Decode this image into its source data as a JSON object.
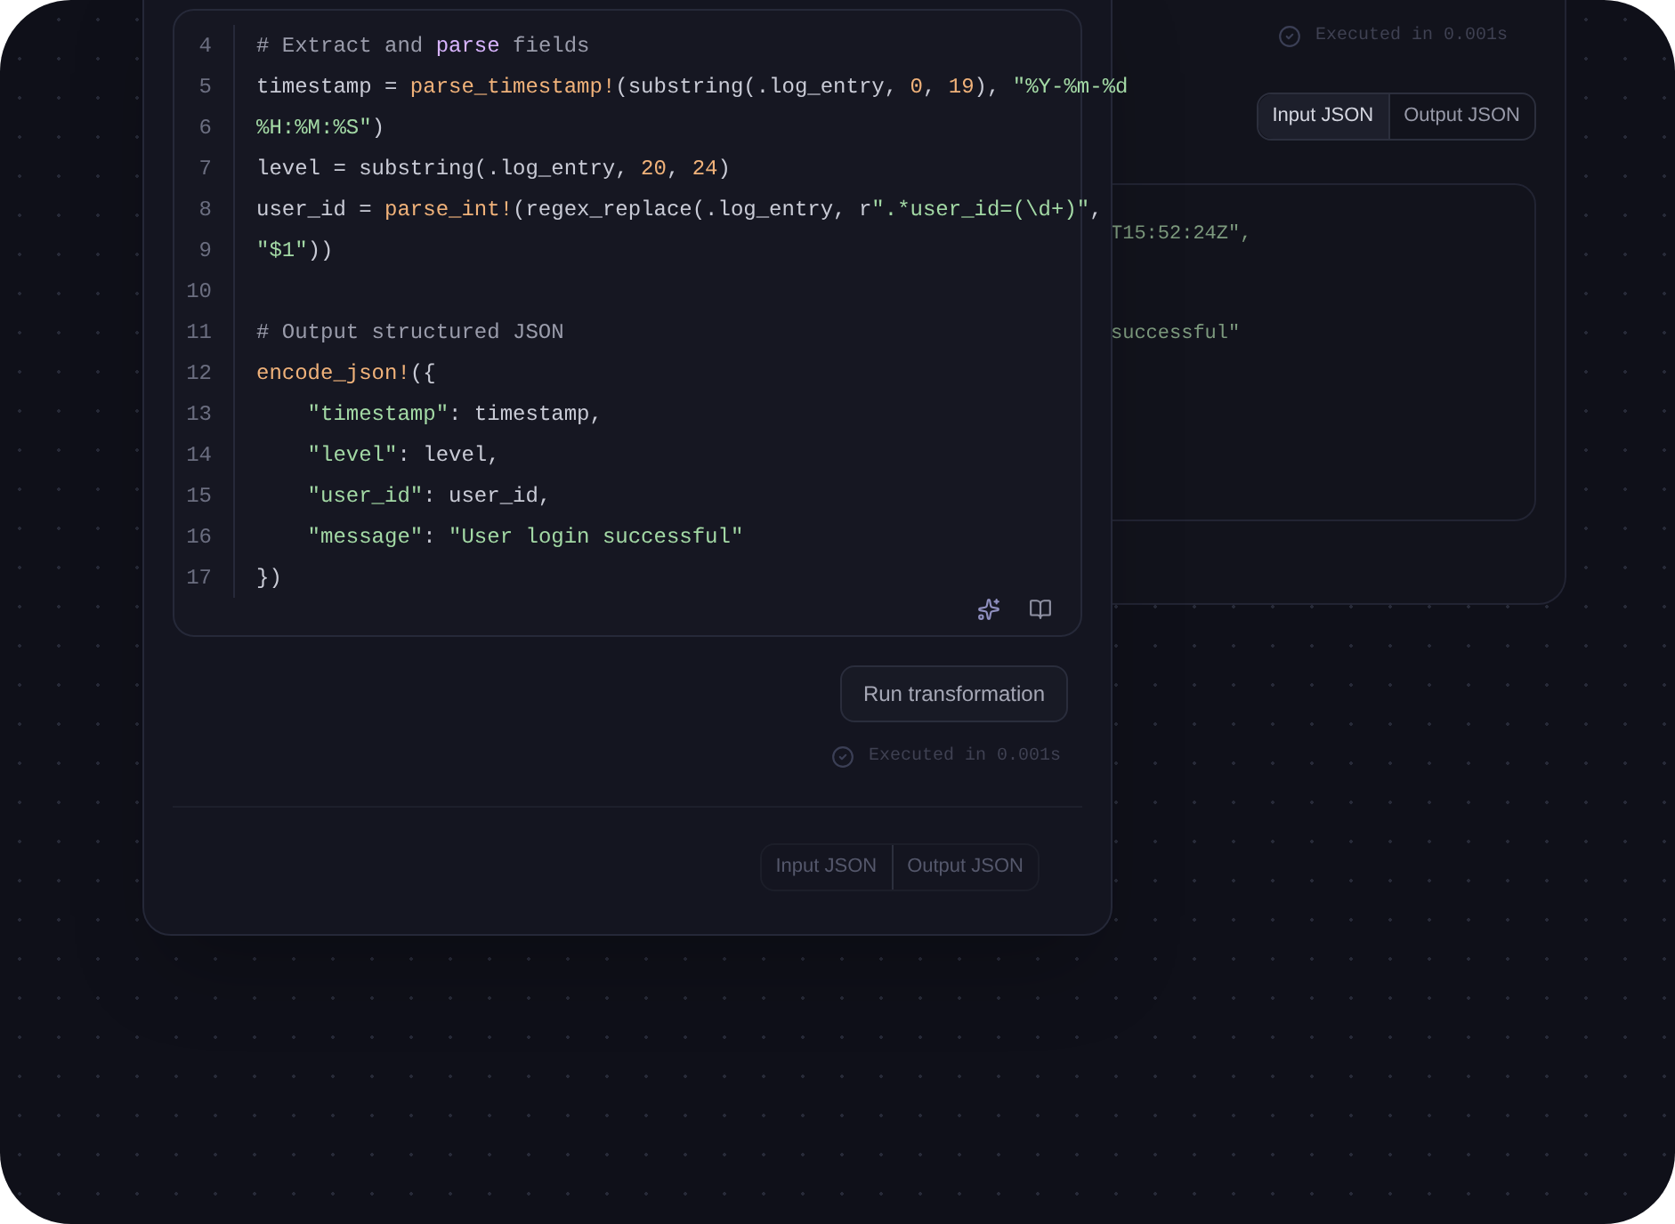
{
  "back_panel": {
    "status": "Executed in 0.001s",
    "tabs": [
      {
        "label": "Input JSON",
        "selected": true
      },
      {
        "label": "Output JSON",
        "selected": false
      }
    ],
    "json_fragments": [
      "T15:52:24Z\",",
      "successful\""
    ]
  },
  "editor": {
    "lines": [
      {
        "number": "4",
        "tokens": [
          {
            "kind": "comment",
            "text": "# Extract and "
          },
          {
            "kind": "keyword",
            "text": "parse"
          },
          {
            "kind": "comment",
            "text": " fields"
          }
        ]
      },
      {
        "number": "5",
        "tokens": [
          {
            "kind": "plain",
            "text": "timestamp = "
          },
          {
            "kind": "function",
            "text": "parse_timestamp!"
          },
          {
            "kind": "plain",
            "text": "(substring(.log_entry, "
          },
          {
            "kind": "number",
            "text": "0"
          },
          {
            "kind": "plain",
            "text": ", "
          },
          {
            "kind": "number",
            "text": "19"
          },
          {
            "kind": "plain",
            "text": "), "
          },
          {
            "kind": "string",
            "text": "\"%Y-%m-%d"
          }
        ]
      },
      {
        "number": "6",
        "tokens": [
          {
            "kind": "string",
            "text": "%H:%M:%S\""
          },
          {
            "kind": "plain",
            "text": ")"
          }
        ]
      },
      {
        "number": "7",
        "tokens": [
          {
            "kind": "plain",
            "text": "level = substring(.log_entry, "
          },
          {
            "kind": "number",
            "text": "20"
          },
          {
            "kind": "plain",
            "text": ", "
          },
          {
            "kind": "number",
            "text": "24"
          },
          {
            "kind": "plain",
            "text": ")"
          }
        ]
      },
      {
        "number": "8",
        "tokens": [
          {
            "kind": "plain",
            "text": "user_id = "
          },
          {
            "kind": "function",
            "text": "parse_int!"
          },
          {
            "kind": "plain",
            "text": "(regex_replace(.log_entry, r"
          },
          {
            "kind": "string",
            "text": "\".*user_id=(\\d+)\""
          },
          {
            "kind": "plain",
            "text": ","
          }
        ]
      },
      {
        "number": "9",
        "tokens": [
          {
            "kind": "string",
            "text": "\"$1\""
          },
          {
            "kind": "plain",
            "text": "))"
          }
        ]
      },
      {
        "number": "10"
      },
      {
        "number": "11",
        "tokens": [
          {
            "kind": "comment",
            "text": "# Output structured JSON"
          }
        ]
      },
      {
        "number": "12",
        "tokens": [
          {
            "kind": "function",
            "text": "encode_json!"
          },
          {
            "kind": "plain",
            "text": "({"
          }
        ]
      },
      {
        "number": "13",
        "tokens": [
          {
            "kind": "string",
            "text": "    \"timestamp\""
          },
          {
            "kind": "plain",
            "text": ": timestamp,"
          }
        ]
      },
      {
        "number": "14",
        "tokens": [
          {
            "kind": "string",
            "text": "    \"level\""
          },
          {
            "kind": "plain",
            "text": ": level,"
          }
        ]
      },
      {
        "number": "15",
        "tokens": [
          {
            "kind": "string",
            "text": "    \"user_id\""
          },
          {
            "kind": "plain",
            "text": ": user_id,"
          }
        ]
      },
      {
        "number": "16",
        "tokens": [
          {
            "kind": "string",
            "text": "    \"message\""
          },
          {
            "kind": "plain",
            "text": ": "
          },
          {
            "kind": "string",
            "text": "\"User login successful\""
          }
        ]
      },
      {
        "number": "17",
        "tokens": [
          {
            "kind": "plain",
            "text": "})"
          }
        ]
      }
    ]
  },
  "run_button": "Run transformation",
  "status": "Executed in 0.001s",
  "tabs": [
    "Input JSON",
    "Output JSON"
  ]
}
